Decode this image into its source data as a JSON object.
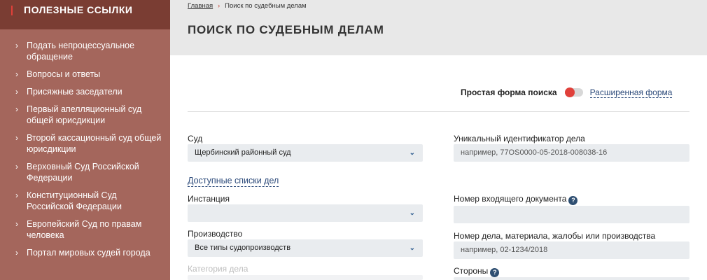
{
  "sidebar": {
    "title": "ПОЛЕЗНЫЕ ССЫЛКИ",
    "items": [
      {
        "label": "Подать непроцессуальное обращение"
      },
      {
        "label": "Вопросы и ответы"
      },
      {
        "label": "Присяжные заседатели"
      },
      {
        "label": "Первый апелляционный суд общей юрисдикции"
      },
      {
        "label": "Второй кассационный суд общей юрисдикции"
      },
      {
        "label": "Верховный Суд Российской Федерации"
      },
      {
        "label": "Конституционный Суд Российской Федерации"
      },
      {
        "label": "Европейский Суд по правам человека"
      },
      {
        "label": "Портал мировых судей города"
      }
    ]
  },
  "breadcrumb": {
    "home": "Главная",
    "separator": "›",
    "current": "Поиск по судебным делам"
  },
  "page": {
    "title": "ПОИСК ПО СУДЕБНЫМ ДЕЛАМ"
  },
  "search_mode": {
    "simple_label": "Простая форма поиска",
    "advanced_link": "Расширенная форма"
  },
  "form": {
    "court": {
      "label": "Суд",
      "value": "Щербинский районный суд"
    },
    "available_lists_link": "Доступные списки дел",
    "instance": {
      "label": "Инстанция",
      "value": ""
    },
    "proceeding": {
      "label": "Производство",
      "value": "Все типы судопроизводств"
    },
    "category": {
      "label": "Категория дела"
    },
    "uid": {
      "label": "Уникальный идентификатор дела",
      "placeholder": "например, 77OS0000-05-2018-008038-16"
    },
    "incoming_doc": {
      "label": "Номер входящего документа",
      "help": "?",
      "value": ""
    },
    "case_number": {
      "label": "Номер дела, материала, жалобы или производства",
      "placeholder": "например, 02-1234/2018"
    },
    "parties": {
      "label": "Стороны",
      "help": "?"
    }
  },
  "colors": {
    "sidebar": "#a4665c",
    "sidebar_head": "#7a3d33",
    "accent_red": "#e0403a",
    "link_blue": "#2c4a7a",
    "field_bg": "#e9ecef"
  }
}
